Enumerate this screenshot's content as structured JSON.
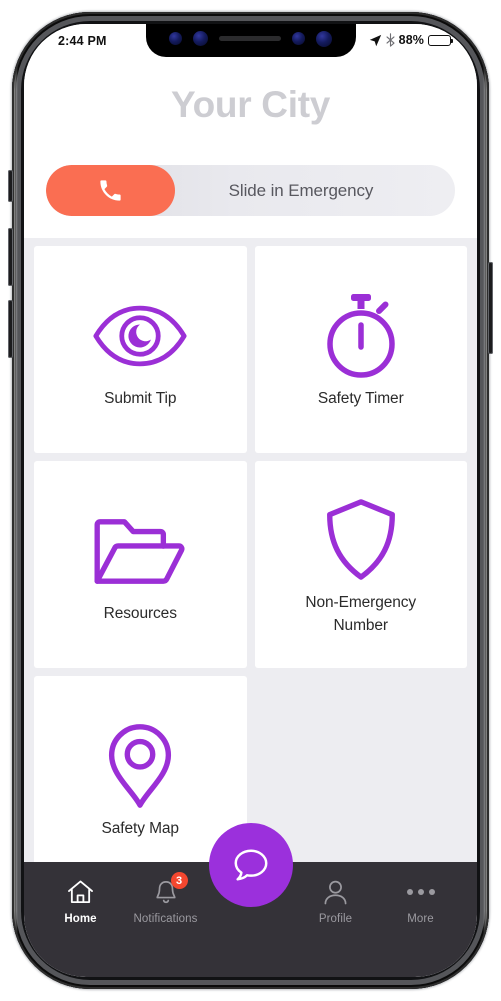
{
  "status_bar": {
    "time": "2:44 PM",
    "battery_percent": "88%",
    "battery_level": 88,
    "icons": [
      "location-arrow-icon",
      "bluetooth-icon",
      "battery-icon"
    ]
  },
  "header": {
    "title": "Your City"
  },
  "emergency_slider": {
    "label": "Slide in Emergency",
    "thumb_icon": "phone-icon",
    "thumb_color": "#FA6E52",
    "track_color": "#E9E9EE"
  },
  "theme": {
    "accent_purple": "#9B30DC",
    "coral": "#FA6E52",
    "badge_red": "#F4472F",
    "nav_dark": "#343238",
    "page_bg": "#EDEDF1",
    "title_gray": "#CDCDD2"
  },
  "tiles": [
    {
      "label": "Submit Tip",
      "icon": "eye-icon"
    },
    {
      "label": "Safety Timer",
      "icon": "stopwatch-icon"
    },
    {
      "label": "Resources",
      "icon": "folder-open-icon"
    },
    {
      "label": "Non-Emergency\nNumber",
      "icon": "shield-icon"
    },
    {
      "label": "Safety Map",
      "icon": "map-pin-icon"
    }
  ],
  "bottom_nav": {
    "items": [
      {
        "label": "Home",
        "icon": "home-icon",
        "active": true,
        "badge": null
      },
      {
        "label": "Notifications",
        "icon": "bell-icon",
        "active": false,
        "badge": "3"
      },
      {
        "label": "Profile",
        "icon": "person-icon",
        "active": false,
        "badge": null
      },
      {
        "label": "More",
        "icon": "ellipsis-icon",
        "active": false,
        "badge": null
      }
    ],
    "fab": {
      "icon": "chat-bubble-icon",
      "color": "#9B30DC"
    }
  }
}
